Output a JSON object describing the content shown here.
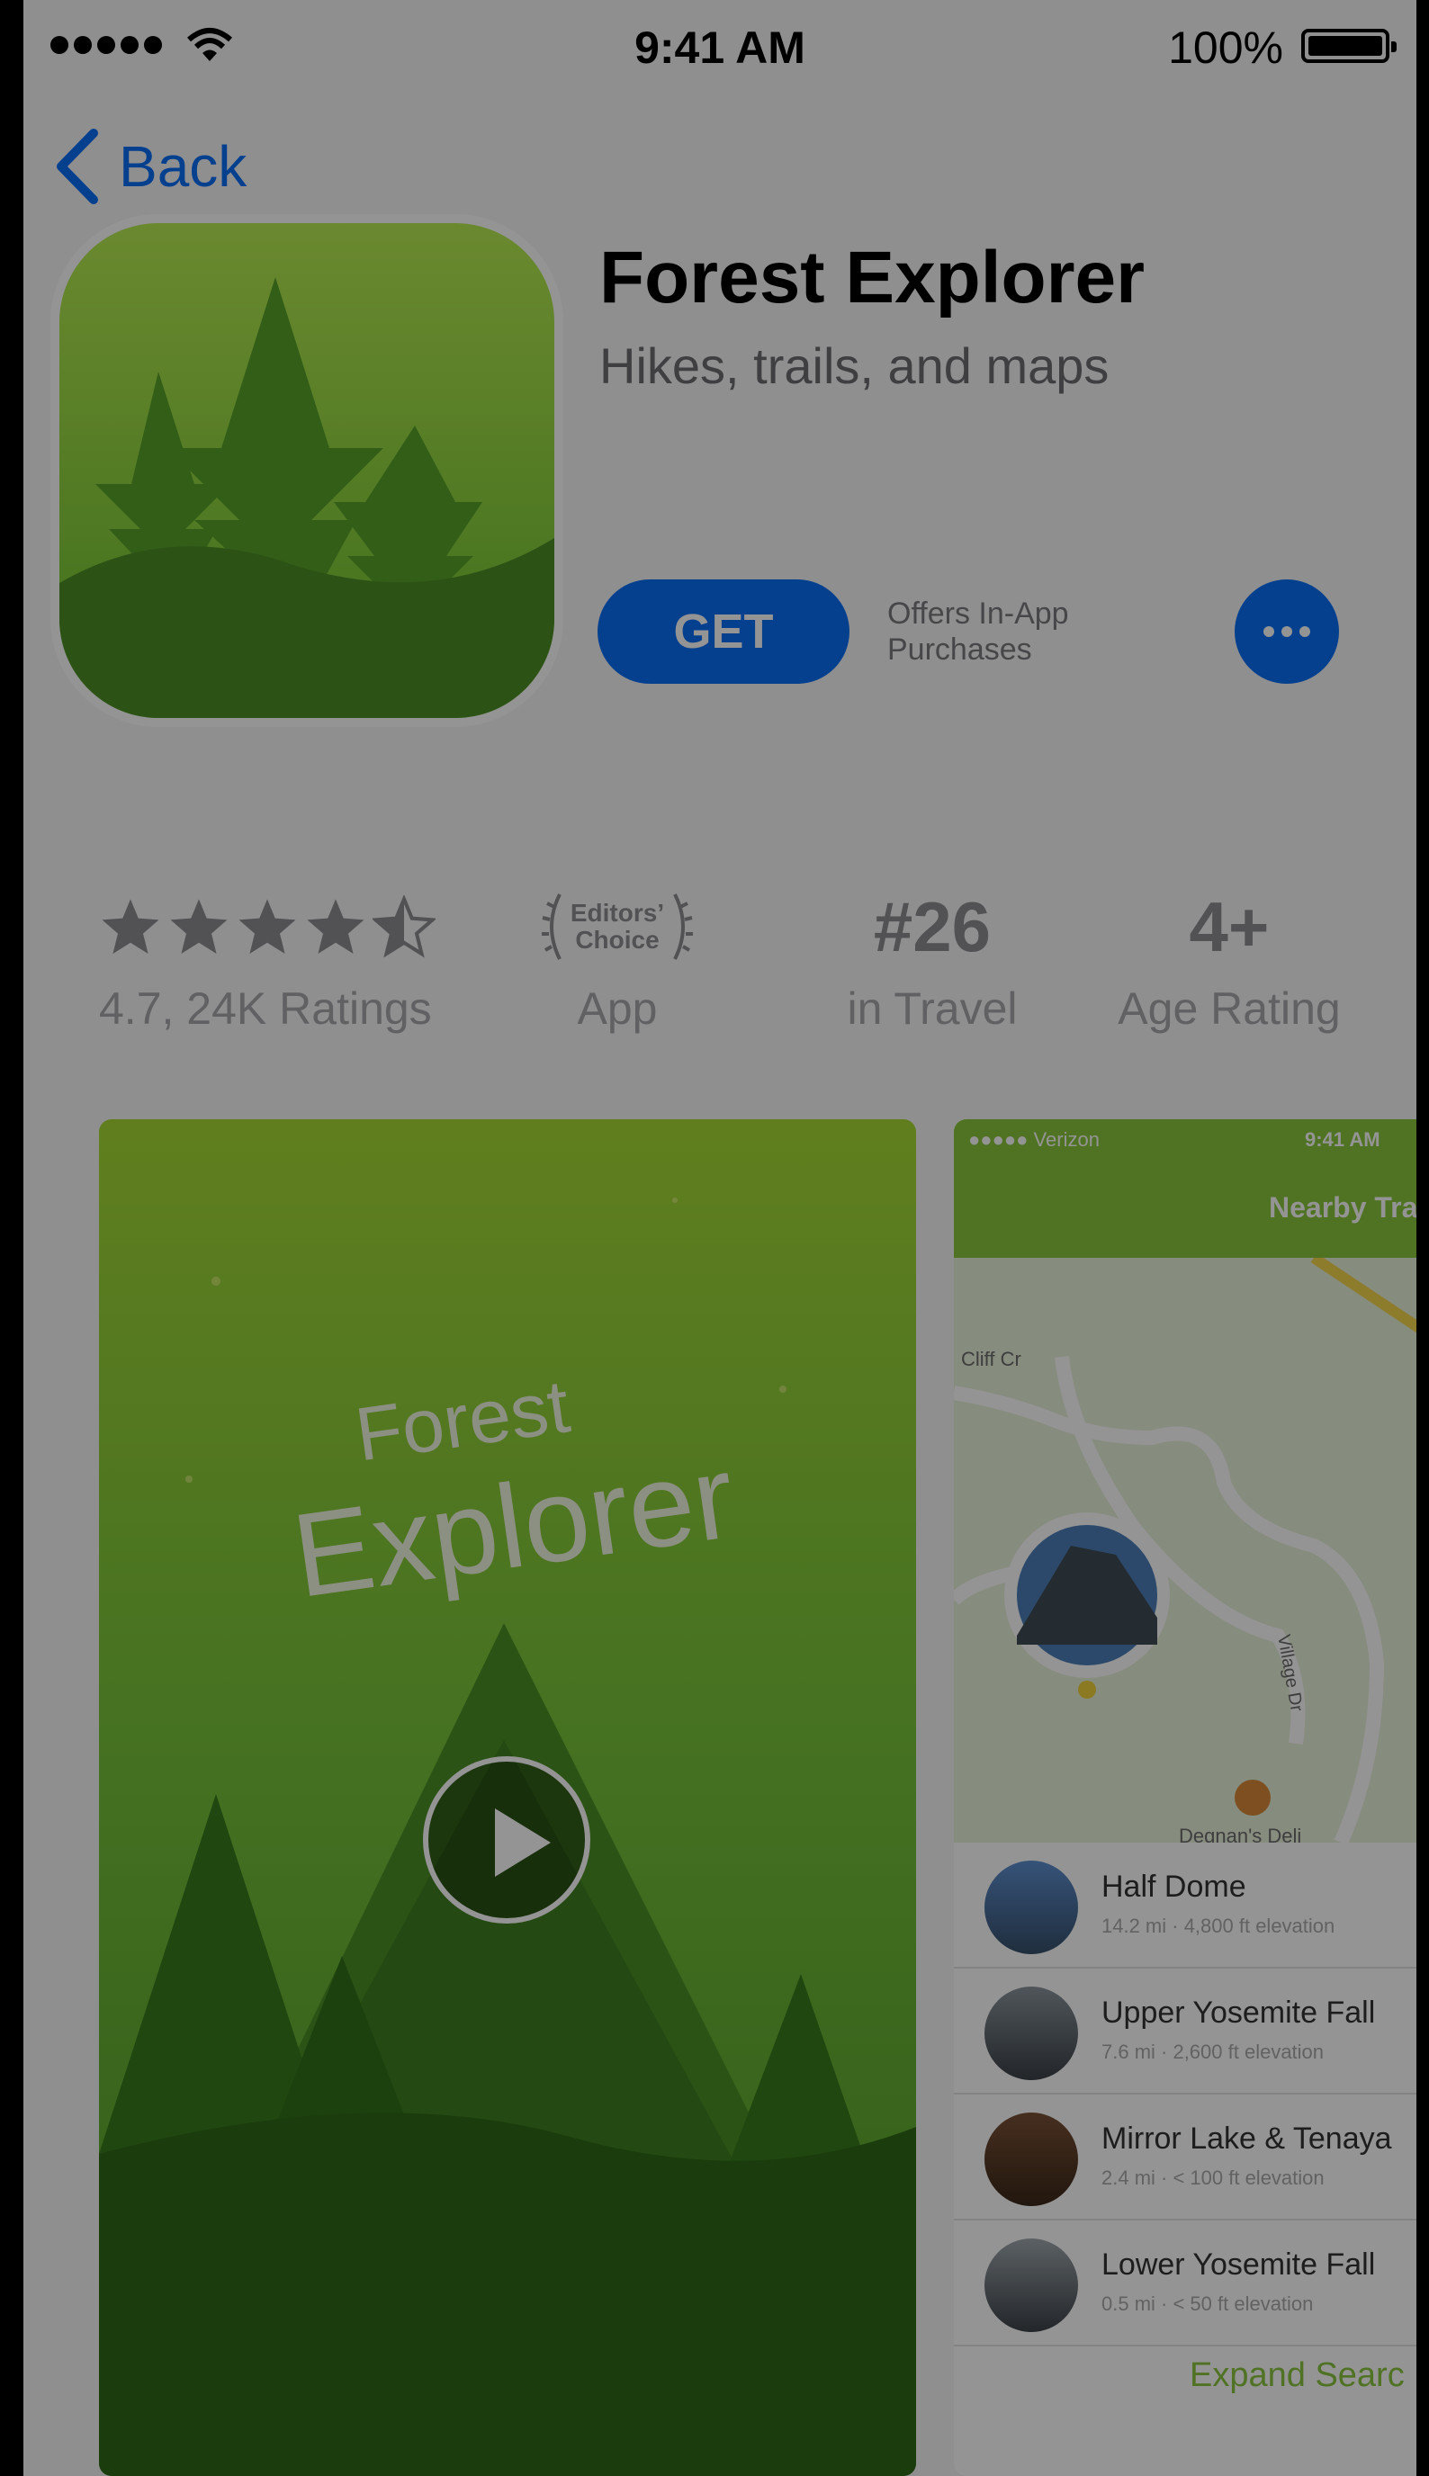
{
  "status_bar": {
    "time": "9:41 AM",
    "battery": "100%"
  },
  "nav": {
    "back_label": "Back"
  },
  "app": {
    "name": "Forest Explorer",
    "subtitle": "Hikes, trails, and maps",
    "get_label": "GET",
    "iap_line1": "Offers In-App",
    "iap_line2": "Purchases"
  },
  "stats": {
    "rating": {
      "stars": 4.7,
      "label": "4.7, 24K Ratings"
    },
    "editors_choice": {
      "line1": "Editors’",
      "line2": "Choice",
      "label": "App"
    },
    "rank": {
      "value": "#26",
      "label": "in Travel"
    },
    "age": {
      "value": "4+",
      "label": "Age Rating"
    }
  },
  "screenshot1": {
    "title_line1": "Forest",
    "title_line2": "Explorer"
  },
  "screenshot2": {
    "carrier": "●●●●● Verizon",
    "time": "9:41 AM",
    "nav_title": "Nearby Tra",
    "map_labels": {
      "street1": "Cliff Cr",
      "street2": "Village Dr",
      "poi": "Degnan's Deli"
    },
    "trails": [
      {
        "name": "Half Dome",
        "meta": "14.2 mi · 4,800 ft elevation"
      },
      {
        "name": "Upper Yosemite Fall",
        "meta": "7.6 mi · 2,600 ft elevation"
      },
      {
        "name": "Mirror Lake & Tenaya",
        "meta": "2.4 mi · < 100 ft elevation"
      },
      {
        "name": "Lower Yosemite Fall",
        "meta": "0.5 mi · < 50 ft elevation"
      }
    ],
    "expand_label": "Expand Searc"
  },
  "colors": {
    "accent": "#0a6ef7",
    "green": "#88c63c",
    "dim_overlay": "rgba(0,0,0,0.42)"
  },
  "icons": [
    "signal-dots",
    "wifi-icon",
    "battery-icon",
    "chevron-left-icon",
    "ellipsis-icon",
    "star-icon",
    "laurel-icon",
    "play-icon",
    "map-pin-icon",
    "fork-knife-icon"
  ]
}
